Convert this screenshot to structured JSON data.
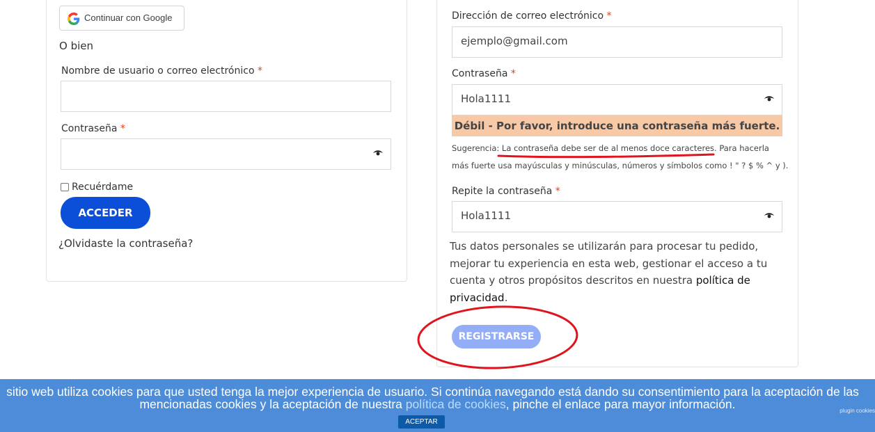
{
  "login": {
    "google_button": "Continuar con Google",
    "or_text": "O bien",
    "username_label": "Nombre de usuario o correo electrónico",
    "username_value": "",
    "password_label": "Contraseña",
    "password_value": "",
    "required_mark": "*",
    "remember_label": "Recuérdame",
    "login_button": "ACCEDER",
    "forgot_link": "¿Olvidaste la contraseña?"
  },
  "register": {
    "email_label": "Dirección de correo electrónico",
    "email_value": "ejemplo@gmail.com",
    "password_label": "Contraseña",
    "password_value": "Hola1111",
    "strength_text": "Débil - Por favor, introduce una contraseña más fuerte.",
    "hint_prefix": "Sugerencia: ",
    "hint_highlight": "La contraseña debe ser de al menos doce caracteres",
    "hint_rest_line1": ". Para hacerla",
    "hint_line2": "más fuerte usa mayúsculas y minúsculas, números y símbolos como ! \" ? $ % ^ y ).",
    "repeat_label": "Repite la contraseña",
    "repeat_value": "Hola1111",
    "privacy_text": "Tus datos personales se utilizarán para procesar tu pedido, mejorar tu experiencia en esta web, gestionar el acceso a tu cuenta y otros propósitos descritos en nuestra ",
    "privacy_link": "política de privacidad",
    "privacy_end": ".",
    "register_button": "REGISTRARSE"
  },
  "cookie_bar": {
    "line1": "sitio web utiliza cookies para que usted tenga la mejor experiencia de usuario. Si continúa navegando está dando su consentimiento para la aceptación de las",
    "line2_before": "mencionadas cookies y la aceptación de nuestra ",
    "line2_link": "política de cookies",
    "line2_after": ", pinche el enlace para mayor información.",
    "accept_button": "ACEPTAR",
    "plugin_text": "plugin cookies"
  },
  "colors": {
    "primary_button": "#0b4fd8",
    "register_button_disabled": "#93aef6",
    "weak_strength_bg": "#f7c9a6",
    "required": "#e2401c",
    "cookie_bar_bg": "#4d8cd9",
    "annotation_red": "#e0141e"
  }
}
